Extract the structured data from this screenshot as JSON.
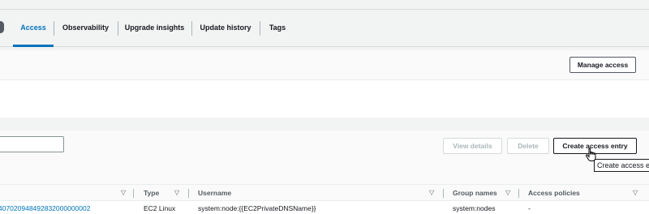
{
  "tabs": [
    {
      "label": "Access",
      "active": true
    },
    {
      "label": "Observability",
      "active": false
    },
    {
      "label": "Upgrade insights",
      "active": false
    },
    {
      "label": "Update history",
      "active": false
    },
    {
      "label": "Tags",
      "active": false
    }
  ],
  "access_panel": {
    "manage_access_label": "Manage access"
  },
  "entries_panel": {
    "view_details_label": "View details",
    "delete_label": "Delete",
    "create_entry_label": "Create access entry",
    "filter_value": "",
    "columns": [
      "Type",
      "Username",
      "Group names",
      "Access policies"
    ],
    "rows": [
      {
        "principal": "407020948492832000000002",
        "type": "EC2 Linux",
        "username": "system:node:{{EC2PrivateDNSName}}",
        "group_names": "system:nodes",
        "access_policies": "-"
      }
    ]
  },
  "tooltip": {
    "text": "Create access entry"
  },
  "colors": {
    "accent": "#0073bb",
    "text": "#16191f",
    "muted": "#545b64",
    "disabled": "#aab7b8"
  }
}
